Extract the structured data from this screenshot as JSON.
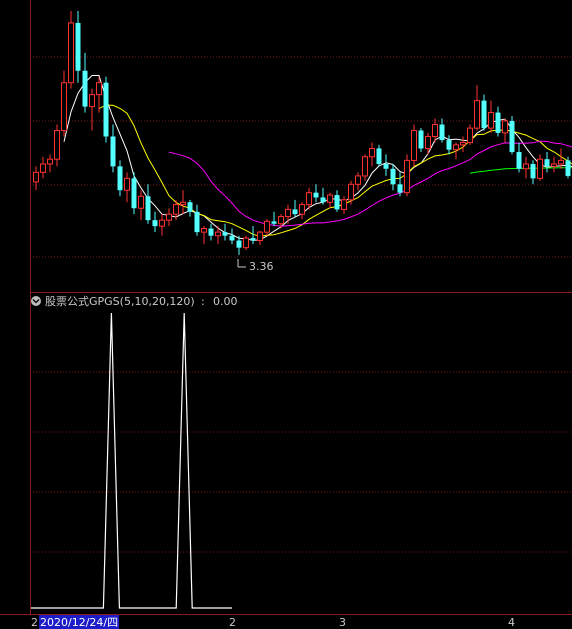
{
  "indicator": {
    "name": "股票公式GPGS(5,10,20,120)",
    "separator": " : ",
    "value": "0.00"
  },
  "price_low_label": "3.36",
  "bottom_axis": {
    "selected_date": "2020/12/24/四",
    "labels": [
      "2",
      "2",
      "3",
      "4"
    ]
  },
  "colors": {
    "background": "#000000",
    "grid": "#7a1515",
    "frame": "#8b1a1a",
    "up": "#ff3232",
    "down": "#54ffff",
    "ma5": "#ffffff",
    "ma10": "#ffff00",
    "ma20": "#ff00ff",
    "ma120": "#00ff00",
    "signal": "#ffffff",
    "date_highlight_bg": "#1c1cc8"
  },
  "chart_data": [
    {
      "type": "candlestick",
      "series_lines": [
        "MA5",
        "MA10",
        "MA20",
        "MA120"
      ],
      "ohlc": [
        [
          3.97,
          4.1,
          3.9,
          4.05
        ],
        [
          4.05,
          4.18,
          4.0,
          4.12
        ],
        [
          4.12,
          4.2,
          4.05,
          4.16
        ],
        [
          4.16,
          4.45,
          4.1,
          4.4
        ],
        [
          4.4,
          4.9,
          4.35,
          4.8
        ],
        [
          4.8,
          5.4,
          4.75,
          5.3
        ],
        [
          5.3,
          5.4,
          4.8,
          4.9
        ],
        [
          4.9,
          5.05,
          4.55,
          4.6
        ],
        [
          4.6,
          4.75,
          4.4,
          4.7
        ],
        [
          4.7,
          4.85,
          4.55,
          4.8
        ],
        [
          4.8,
          4.85,
          4.3,
          4.35
        ],
        [
          4.35,
          4.45,
          4.05,
          4.1
        ],
        [
          4.1,
          4.15,
          3.85,
          3.9
        ],
        [
          3.9,
          4.05,
          3.8,
          4.0
        ],
        [
          4.0,
          4.05,
          3.7,
          3.75
        ],
        [
          3.75,
          3.9,
          3.65,
          3.85
        ],
        [
          3.85,
          3.95,
          3.62,
          3.65
        ],
        [
          3.65,
          3.72,
          3.55,
          3.6
        ],
        [
          3.6,
          3.7,
          3.52,
          3.65
        ],
        [
          3.65,
          3.75,
          3.6,
          3.7
        ],
        [
          3.7,
          3.82,
          3.65,
          3.78
        ],
        [
          3.78,
          3.9,
          3.7,
          3.8
        ],
        [
          3.8,
          3.82,
          3.68,
          3.72
        ],
        [
          3.72,
          3.78,
          3.52,
          3.55
        ],
        [
          3.55,
          3.6,
          3.45,
          3.58
        ],
        [
          3.58,
          3.62,
          3.48,
          3.52
        ],
        [
          3.52,
          3.6,
          3.45,
          3.55
        ],
        [
          3.55,
          3.62,
          3.48,
          3.52
        ],
        [
          3.52,
          3.58,
          3.45,
          3.48
        ],
        [
          3.48,
          3.52,
          3.36,
          3.42
        ],
        [
          3.42,
          3.52,
          3.4,
          3.5
        ],
        [
          3.5,
          3.6,
          3.45,
          3.48
        ],
        [
          3.48,
          3.56,
          3.44,
          3.55
        ],
        [
          3.55,
          3.66,
          3.52,
          3.64
        ],
        [
          3.64,
          3.72,
          3.6,
          3.62
        ],
        [
          3.62,
          3.7,
          3.58,
          3.68
        ],
        [
          3.68,
          3.78,
          3.62,
          3.74
        ],
        [
          3.74,
          3.82,
          3.68,
          3.7
        ],
        [
          3.7,
          3.8,
          3.66,
          3.78
        ],
        [
          3.78,
          3.92,
          3.74,
          3.88
        ],
        [
          3.88,
          3.95,
          3.8,
          3.84
        ],
        [
          3.84,
          3.92,
          3.78,
          3.8
        ],
        [
          3.8,
          3.88,
          3.75,
          3.86
        ],
        [
          3.86,
          3.9,
          3.72,
          3.74
        ],
        [
          3.74,
          3.85,
          3.7,
          3.82
        ],
        [
          3.82,
          3.98,
          3.78,
          3.95
        ],
        [
          3.95,
          4.05,
          3.9,
          4.02
        ],
        [
          4.02,
          4.2,
          3.98,
          4.18
        ],
        [
          4.18,
          4.3,
          4.1,
          4.25
        ],
        [
          4.25,
          4.28,
          4.1,
          4.12
        ],
        [
          4.12,
          4.2,
          4.02,
          4.08
        ],
        [
          4.08,
          4.12,
          3.9,
          3.95
        ],
        [
          3.95,
          4.05,
          3.85,
          3.88
        ],
        [
          3.88,
          4.2,
          3.85,
          4.15
        ],
        [
          4.15,
          4.45,
          4.1,
          4.4
        ],
        [
          4.4,
          4.42,
          4.22,
          4.25
        ],
        [
          4.25,
          4.38,
          4.2,
          4.35
        ],
        [
          4.35,
          4.5,
          4.3,
          4.45
        ],
        [
          4.45,
          4.5,
          4.3,
          4.32
        ],
        [
          4.32,
          4.36,
          4.2,
          4.24
        ],
        [
          4.24,
          4.3,
          4.16,
          4.28
        ],
        [
          4.28,
          4.35,
          4.22,
          4.3
        ],
        [
          4.3,
          4.45,
          4.28,
          4.42
        ],
        [
          4.42,
          4.78,
          4.4,
          4.65
        ],
        [
          4.65,
          4.7,
          4.4,
          4.42
        ],
        [
          4.42,
          4.65,
          4.38,
          4.55
        ],
        [
          4.55,
          4.6,
          4.35,
          4.38
        ],
        [
          4.38,
          4.5,
          4.3,
          4.48
        ],
        [
          4.48,
          4.52,
          4.2,
          4.22
        ],
        [
          4.22,
          4.3,
          4.05,
          4.08
        ],
        [
          4.08,
          4.18,
          4.0,
          4.12
        ],
        [
          4.12,
          4.15,
          3.95,
          4.0
        ],
        [
          4.0,
          4.2,
          3.98,
          4.16
        ],
        [
          4.16,
          4.22,
          4.05,
          4.1
        ],
        [
          4.1,
          4.18,
          4.05,
          4.12
        ],
        [
          4.12,
          4.25,
          4.08,
          4.15
        ],
        [
          4.15,
          4.18,
          4.0,
          4.02
        ],
        [
          4.02,
          4.1,
          3.96,
          4.06
        ],
        [
          4.06,
          4.08,
          3.9,
          3.92
        ]
      ]
    },
    {
      "type": "line",
      "series": [
        {
          "name": "GPGS",
          "values": [
            0,
            0,
            0,
            0,
            0,
            0,
            0,
            0,
            0,
            0,
            0,
            0,
            0,
            0,
            0,
            0,
            0,
            0,
            0,
            0,
            0,
            0,
            0,
            0,
            0,
            0,
            0,
            0,
            0,
            0,
            0,
            0,
            0,
            0,
            0,
            0,
            0,
            0,
            0,
            0,
            0,
            0,
            0,
            0,
            0,
            0,
            0,
            0,
            0,
            0,
            0,
            0,
            0,
            0,
            0,
            0,
            0,
            0,
            0,
            0,
            0,
            0,
            0,
            0,
            0,
            0,
            0,
            0,
            0,
            0,
            0,
            0,
            0,
            0,
            0,
            0,
            0,
            0,
            0,
            0,
            0,
            0,
            0,
            0,
            0,
            0,
            0,
            0,
            0,
            0,
            0,
            0,
            0,
            0,
            0,
            0,
            0,
            0,
            0,
            0,
            0,
            0,
            0,
            0,
            0,
            0,
            0,
            0,
            0,
            0,
            0,
            0,
            0,
            0,
            0,
            0,
            0,
            0,
            0,
            0,
            0,
            0,
            0,
            0,
            0,
            0,
            0,
            0,
            0,
            0,
            0,
            0,
            0,
            0,
            0,
            0,
            0,
            0,
            0,
            0,
            0,
            0,
            0,
            0,
            0,
            0,
            0,
            0,
            0,
            0,
            0,
            0,
            0,
            0,
            0,
            0,
            0,
            0,
            0,
            0,
            0,
            0,
            0,
            0,
            0,
            0,
            0,
            0,
            0,
            0,
            0,
            0,
            0,
            0,
            0,
            0,
            0,
            0,
            0,
            0
          ]
        }
      ],
      "spikes": [
        {
          "index": 14,
          "value": 1
        },
        {
          "index": 27,
          "value": 1
        }
      ]
    }
  ]
}
